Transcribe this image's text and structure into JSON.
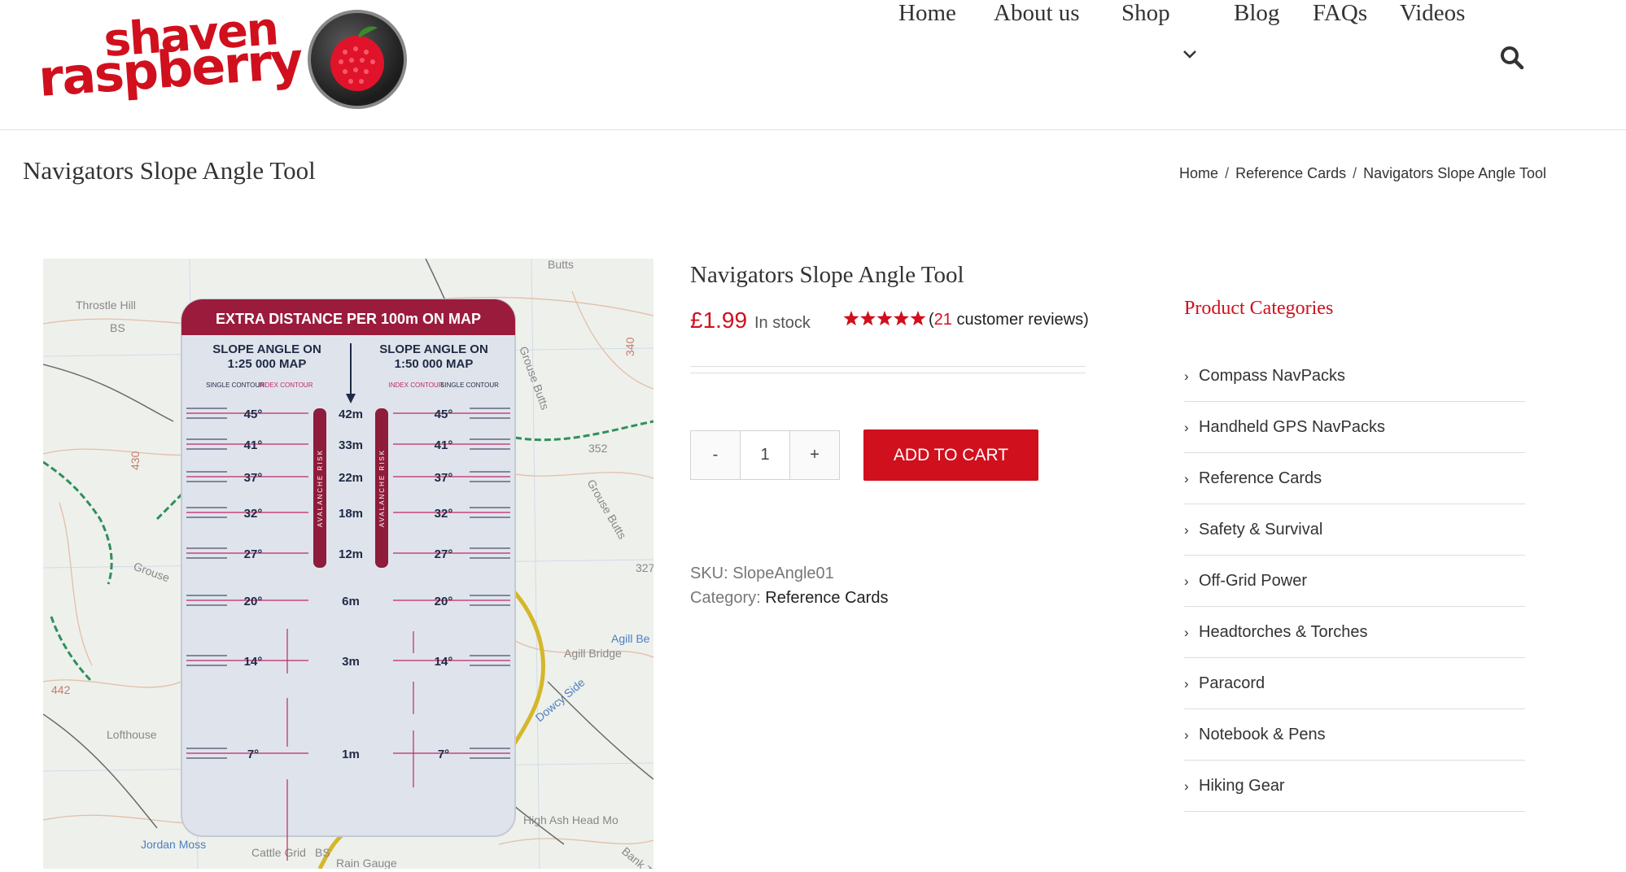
{
  "brand": {
    "line1": "shaven",
    "line2": "raspberry"
  },
  "nav": {
    "items": [
      {
        "label": "Home"
      },
      {
        "label": "About us"
      },
      {
        "label": "Shop"
      },
      {
        "label": "Blog"
      },
      {
        "label": "FAQs"
      },
      {
        "label": "Videos"
      }
    ],
    "shop_icon": "chevron-down-icon",
    "search_icon": "search-icon"
  },
  "page": {
    "title": "Navigators Slope Angle Tool"
  },
  "breadcrumb": {
    "home": "Home",
    "category": "Reference Cards",
    "current": "Navigators Slope Angle Tool",
    "separator": "/"
  },
  "product": {
    "title": "Navigators Slope Angle Tool",
    "price": "£1.99",
    "stock": "In stock",
    "rating": 5,
    "review_open": "(",
    "review_count": "21",
    "review_text": " customer reviews)",
    "quantity": "1",
    "minus": "-",
    "plus": "+",
    "add_to_cart": "ADD TO CART",
    "sku_label": "SKU:",
    "sku": "SlopeAngle01",
    "category_label": "Category:",
    "category": "Reference Cards"
  },
  "image": {
    "card_header": "EXTRA DISTANCE PER 100m ON MAP",
    "col_left_title1": "SLOPE ANGLE ON",
    "col_left_title2": "1:25 000 MAP",
    "col_right_title1": "SLOPE ANGLE ON",
    "col_right_title2": "1:50 000 MAP",
    "single_contour": "SINGLE CONTOUR",
    "index_contour": "INDEX CONTOUR",
    "risk": "AVALANCHE RISK",
    "rows": [
      {
        "angle": "45°",
        "dist": "42m"
      },
      {
        "angle": "41°",
        "dist": "33m"
      },
      {
        "angle": "37°",
        "dist": "22m"
      },
      {
        "angle": "32°",
        "dist": "18m"
      },
      {
        "angle": "27°",
        "dist": "12m"
      },
      {
        "angle": "20°",
        "dist": "6m"
      },
      {
        "angle": "14°",
        "dist": "3m"
      },
      {
        "angle": "7°",
        "dist": "1m"
      }
    ],
    "map_labels": [
      "Butts",
      "Throstle Hill",
      "BS",
      "Grouse Butts",
      "352",
      "Grouse Butts",
      "Grouse",
      "327",
      "Agill Bridge",
      "Agill Be",
      "Dowcy Side",
      "Lofthouse",
      "Jordan Moss",
      "Cattle Grid",
      "BS",
      "Rain Gauge",
      "High Ash Head Mo",
      "Bank Top",
      "442",
      "430",
      "340"
    ]
  },
  "sidebar": {
    "title": "Product Categories",
    "categories": [
      {
        "label": "Compass NavPacks"
      },
      {
        "label": "Handheld GPS NavPacks"
      },
      {
        "label": "Reference Cards"
      },
      {
        "label": "Safety & Survival"
      },
      {
        "label": "Off-Grid Power"
      },
      {
        "label": "Headtorches & Torches"
      },
      {
        "label": "Paracord"
      },
      {
        "label": "Notebook & Pens"
      },
      {
        "label": "Hiking Gear"
      }
    ]
  },
  "colors": {
    "accent": "#d0101d",
    "card_header": "#9b1b3c",
    "text": "#333333"
  }
}
